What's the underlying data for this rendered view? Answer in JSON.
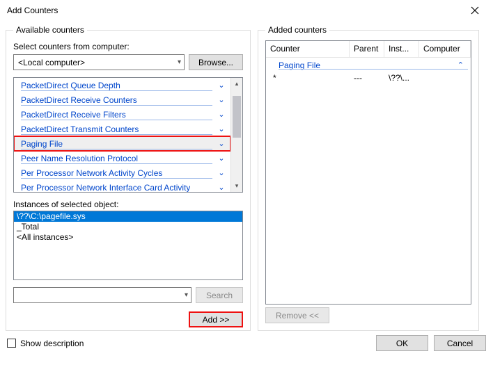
{
  "title": "Add Counters",
  "left": {
    "legend": "Available counters",
    "select_label": "Select counters from computer:",
    "computer": "<Local computer>",
    "browse": "Browse...",
    "counters": [
      "PacketDirect Queue Depth",
      "PacketDirect Receive Counters",
      "PacketDirect Receive Filters",
      "PacketDirect Transmit Counters",
      "Paging File",
      "Peer Name Resolution Protocol",
      "Per Processor Network Activity Cycles",
      "Per Processor Network Interface Card Activity"
    ],
    "selected_index": 4,
    "instances_label": "Instances of selected object:",
    "instances": [
      "\\??\\C:\\pagefile.sys",
      "_Total",
      "<All instances>"
    ],
    "instance_selected_index": 0,
    "search": "Search",
    "add": "Add >>"
  },
  "right": {
    "legend": "Added counters",
    "columns": {
      "counter": "Counter",
      "parent": "Parent",
      "inst": "Inst...",
      "computer": "Computer"
    },
    "group": "Paging File",
    "row": {
      "counter": "*",
      "parent": "---",
      "inst": "\\??\\...",
      "computer": ""
    },
    "remove": "Remove <<"
  },
  "footer": {
    "show_desc": "Show description",
    "ok": "OK",
    "cancel": "Cancel"
  }
}
